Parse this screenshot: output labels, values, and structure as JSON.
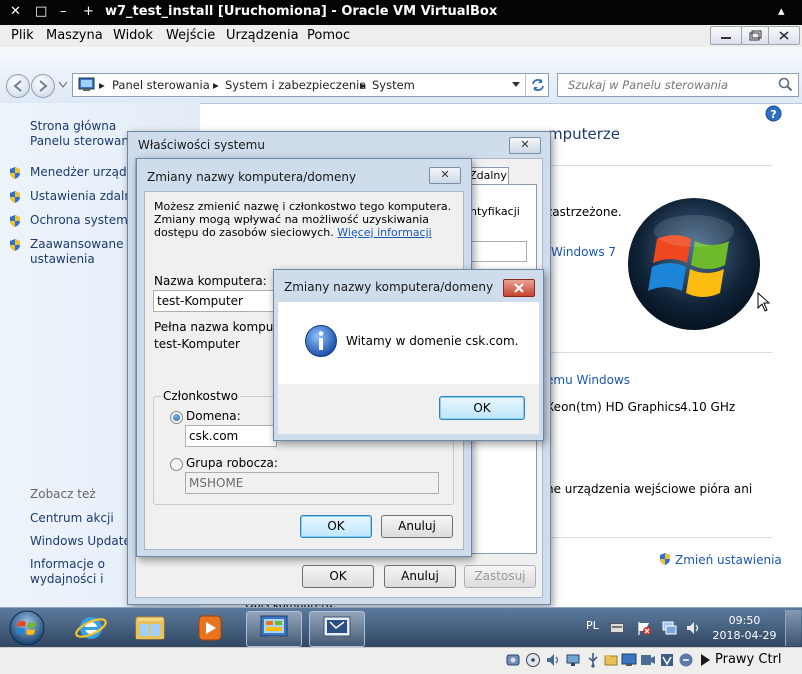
{
  "host": {
    "title": "w7_test_install [Uruchomiona] - Oracle VM VirtualBox",
    "menu": [
      "Plik",
      "Maszyna",
      "Widok",
      "Wejście",
      "Urządzenia",
      "Pomoc"
    ],
    "host_key": "Prawy Ctrl"
  },
  "explorer": {
    "breadcrumb": [
      "Panel sterowania",
      "System i zabezpieczenia",
      "System"
    ],
    "search_placeholder": "Szukaj w Panelu sterowania"
  },
  "leftnav": {
    "home": "Strona główna Panelu sterowania",
    "items": [
      "Menedżer urządzeń",
      "Ustawienia zdalne",
      "Ochrona systemu",
      "Zaawansowane ustawienia systemu"
    ],
    "see_also_title": "Zobacz też",
    "see_also": [
      "Centrum akcji",
      "Windows Update",
      "Informacje o wydajności i narzędzia"
    ]
  },
  "content": {
    "title_fragment": "mputerze",
    "rights_fragment": "zastrzeżone.",
    "edition_fragment": "Windows 7",
    "rating_fragment": "emu Windows",
    "processor_fragment": "Xeon(tm) HD Graphics",
    "processor_speed": "4.10 GHz",
    "pen_fragment": "ne urządzenia wejściowe pióra ani",
    "change_settings": "Zmień ustawienia",
    "bottom_fragment": "Opis komputera:"
  },
  "sysprops": {
    "title": "Właściwości systemu",
    "tab_visible": "Zdalny",
    "identify_fragment": "ntyfikacji",
    "ok": "OK",
    "cancel": "Anuluj",
    "apply": "Zastosuj"
  },
  "rename": {
    "title": "Zmiany nazwy komputera/domeny",
    "description": "Możesz zmienić nazwę i członkostwo tego komputera. Zmiany mogą wpływać na możliwość uzyskiwania dostępu do zasobów sieciowych.",
    "more_info": "Więcej informacji",
    "computer_name_label": "Nazwa komputera:",
    "computer_name_value": "test-Komputer",
    "full_name_label": "Pełna nazwa komputera:",
    "full_name_value": "test-Komputer",
    "membership_label": "Członkostwo",
    "domain_label": "Domena:",
    "domain_value": "csk.com",
    "workgroup_label": "Grupa robocza:",
    "workgroup_value": "MSHOME",
    "ok": "OK",
    "cancel": "Anuluj"
  },
  "welcome": {
    "title": "Zmiany nazwy komputera/domeny",
    "message": "Witamy w domenie csk.com.",
    "ok": "OK"
  },
  "tray": {
    "language": "PL",
    "time": "09:50",
    "date": "2018-04-29"
  },
  "colors": {
    "link": "#1a57b0",
    "taskbar": "#3b5676",
    "dialog_frame": "#cfdcec"
  }
}
